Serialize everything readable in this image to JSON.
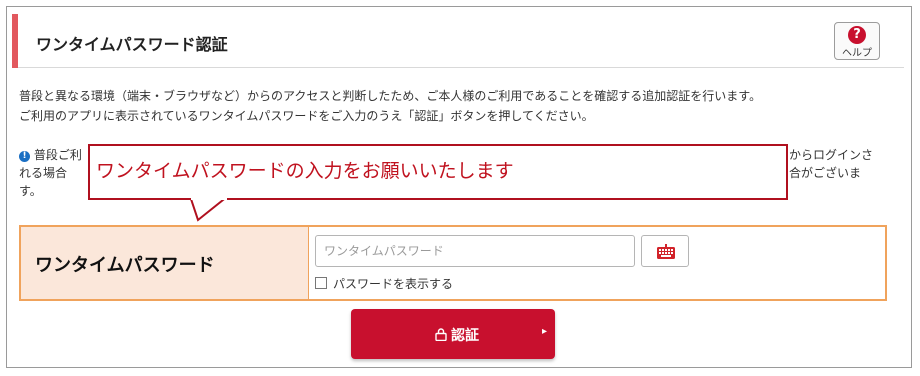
{
  "header": {
    "title": "ワンタイムパスワード認証",
    "help_label": "ヘルプ",
    "help_glyph": "?"
  },
  "intro": {
    "line1": "普段と異なる環境（端末・ブラウザなど）からのアクセスと判断したため、ご本人様のご利用であることを確認する追加認証を行います。",
    "line2": "ご利用のアプリに表示されているワンタイムパスワードをご入力のうえ「認証」ボタンを押してください。"
  },
  "note": {
    "icon_glyph": "!",
    "left1": "普段ご利",
    "left2": "れる場合",
    "left3": "す。",
    "right1": "からログインさ",
    "right2": "合がございま"
  },
  "callout": {
    "text": "ワンタイムパスワードの入力をお願いいたします"
  },
  "form": {
    "label": "ワンタイムパスワード",
    "input_placeholder": "ワンタイムパスワード",
    "input_value": "",
    "show_password_label": "パスワードを表示する"
  },
  "submit": {
    "label": "認証",
    "icon": "lock-icon",
    "arrow": "▸"
  },
  "colors": {
    "accent": "#c8102e",
    "header_bar": "#e2585e",
    "form_border": "#f0a35c",
    "label_bg": "#fbe7da"
  }
}
